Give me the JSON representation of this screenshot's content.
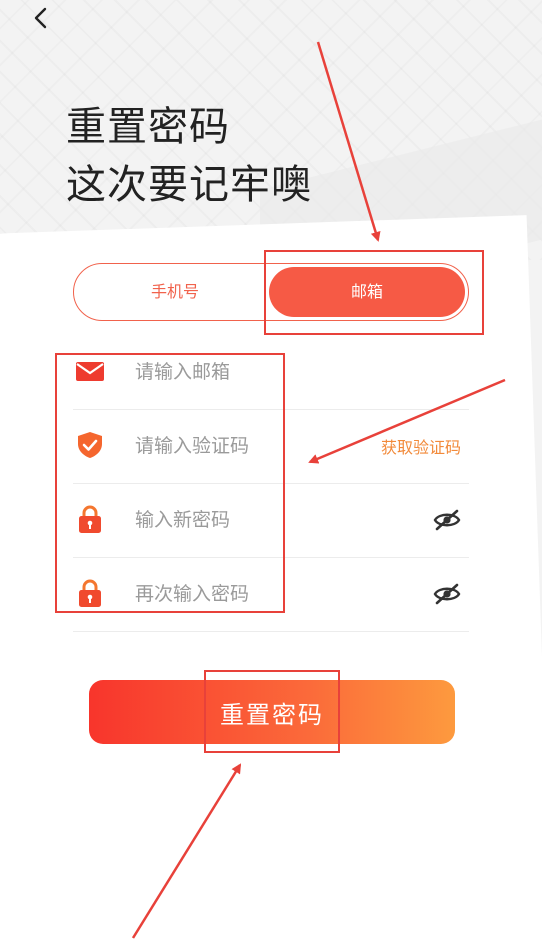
{
  "header": {
    "title_line1": "重置密码",
    "title_line2": "这次要记牢噢"
  },
  "tabs": [
    {
      "label": "手机号",
      "active": false
    },
    {
      "label": "邮箱",
      "active": true
    }
  ],
  "form": {
    "email_placeholder": "请输入邮箱",
    "code_placeholder": "请输入验证码",
    "get_code_label": "获取验证码",
    "new_password_placeholder": "输入新密码",
    "confirm_password_placeholder": "再次输入密码"
  },
  "submit_label": "重置密码",
  "colors": {
    "accent": "#f65a45",
    "code_link": "#f28a3a",
    "annotation": "#e8413a"
  }
}
